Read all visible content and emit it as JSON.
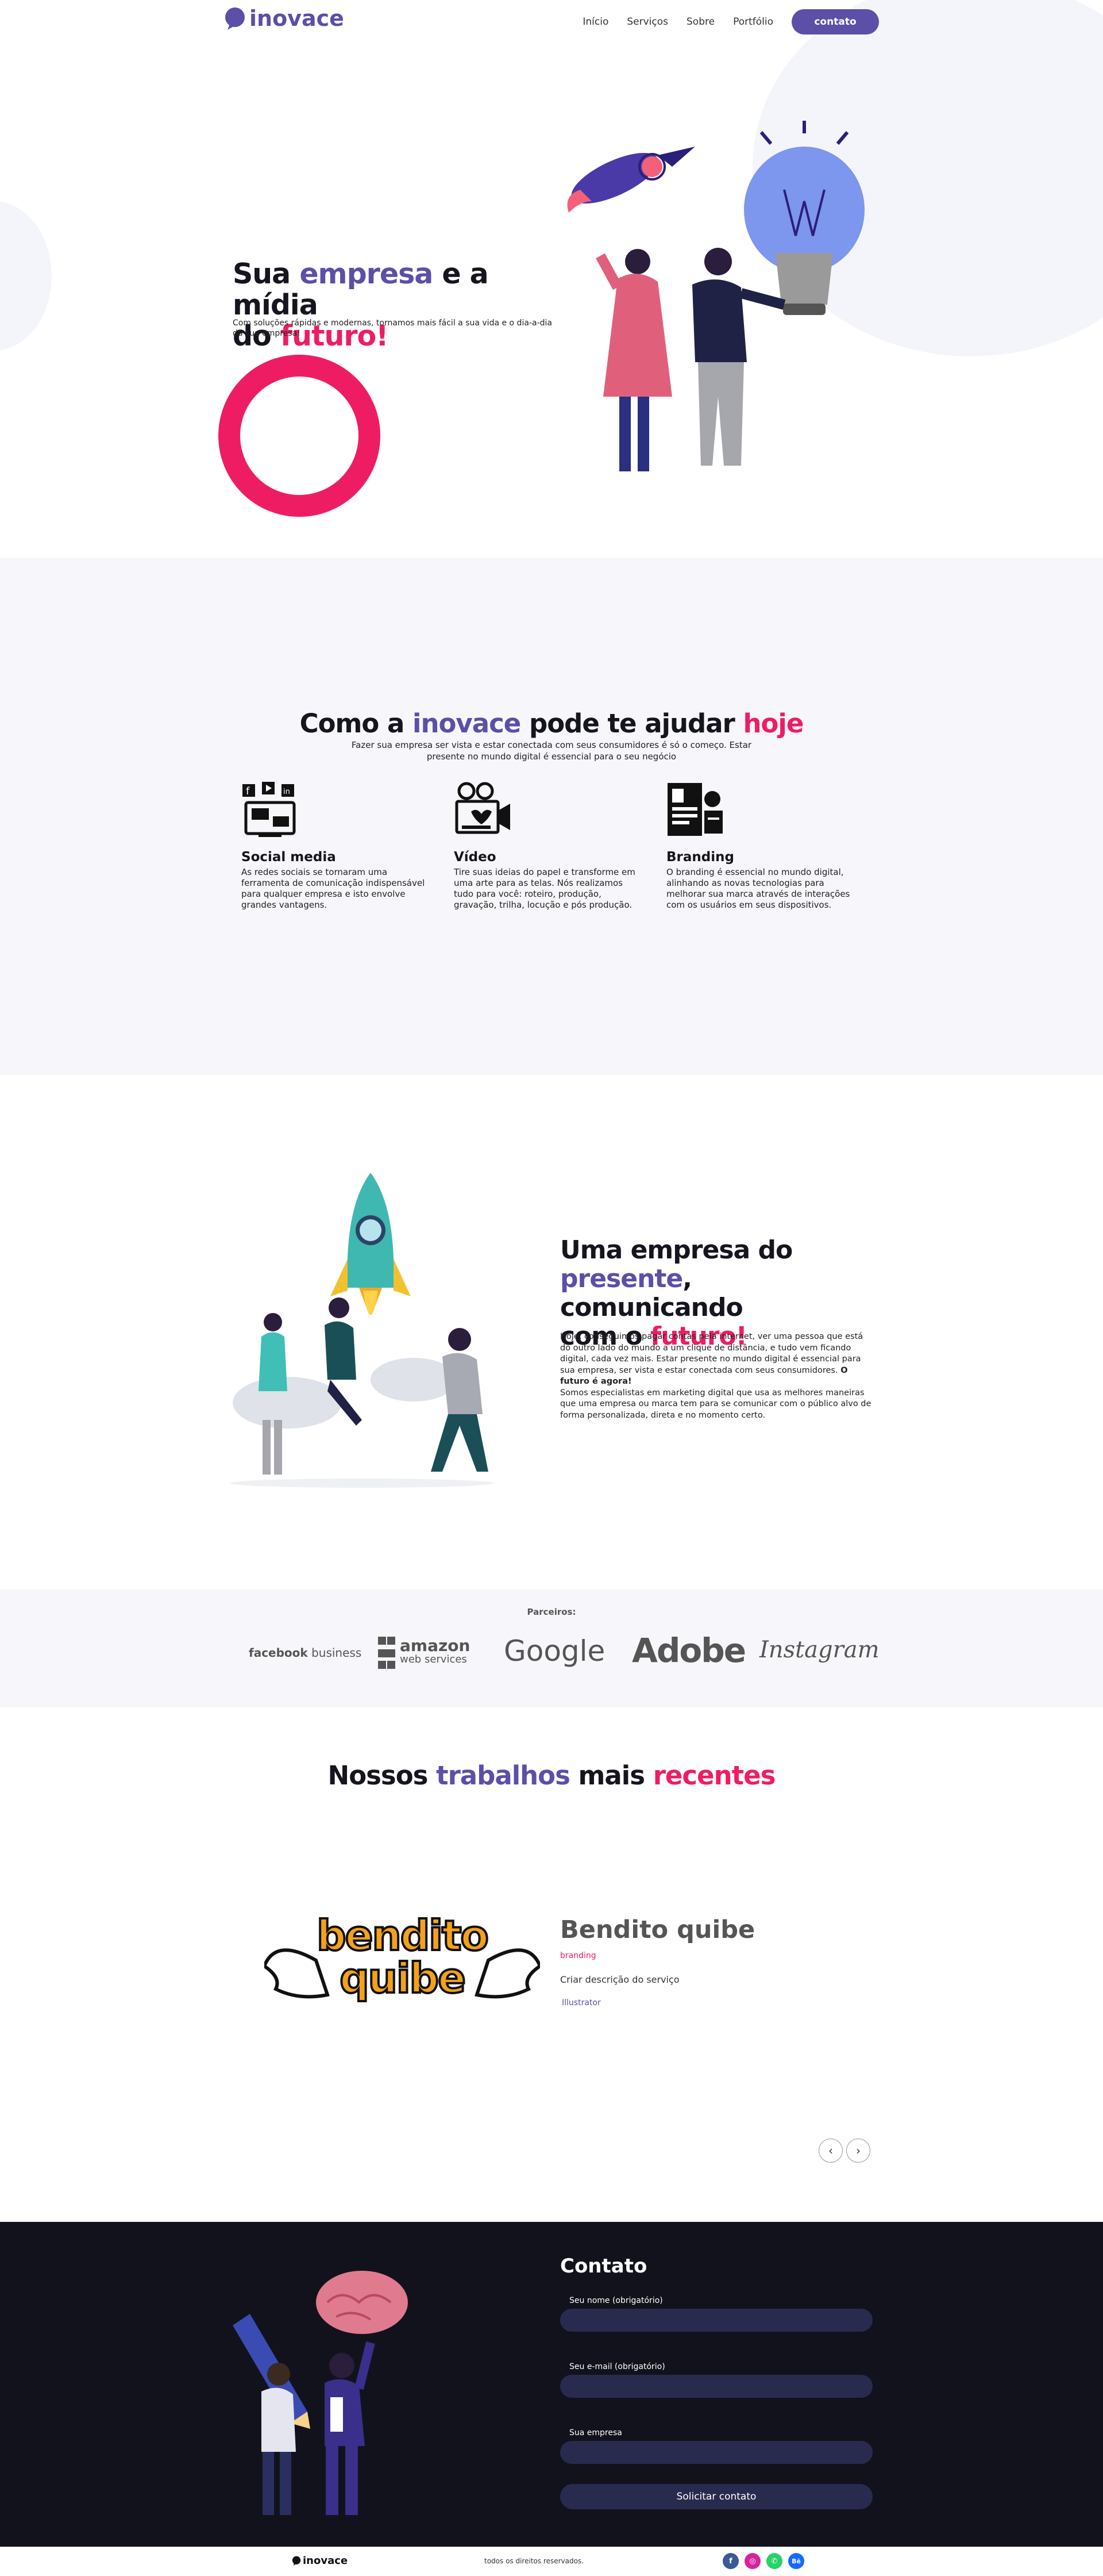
{
  "header": {
    "logo_text": "inovace",
    "nav": [
      "Início",
      "Serviços",
      "Sobre",
      "Portfólio"
    ],
    "cta": "contato"
  },
  "hero": {
    "title_1": "Sua ",
    "title_2": "empresa",
    "title_3": " e a mídia",
    "title_4": "do ",
    "title_5": "futuro!",
    "subtitle": "Com soluções rápidas e modernas, tornamos mais fácil a sua vida e o dia-a-dia da sua empresa!"
  },
  "services": {
    "title_1": "Como a ",
    "title_2": "inovace",
    "title_3": " pode te ajudar ",
    "title_4": "hoje",
    "subtitle": "Fazer sua empresa ser vista e estar conectada com seus consumidores é só o começo. Estar presente no mundo digital é essencial para o seu negócio",
    "items": [
      {
        "title": "Social media",
        "text": "As redes sociais se tornaram uma ferramenta de comunicação indispensável para qualquer empresa e isto envolve grandes vantagens.",
        "icon": "social-media-icon"
      },
      {
        "title": "Vídeo",
        "text": "Tire suas ideias do papel e transforme em uma arte para as telas. Nós realizamos tudo para você: roteiro, produção, gravação, trilha, locução e pós produção.",
        "icon": "video-icon"
      },
      {
        "title": "Branding",
        "text": "O branding é essencial no mundo digital, alinhando as novas tecnologias para melhorar sua marca através de interações com os usuários em seus dispositivos.",
        "icon": "branding-icon"
      }
    ]
  },
  "about": {
    "title_1": "Uma empresa do",
    "title_2": "presente",
    "title_3": ", comunicando",
    "title_4": "com o ",
    "title_5": "futuro!",
    "para_1": "Hoje, conseguimos pagar contas pela internet, ver uma pessoa que está do outro lado do mundo a um clique de distância, e tudo vem ficando digital, cada vez mais. Estar presente no mundo digital é essencial para sua empresa, ser vista e estar conectada com seus consumidores. ",
    "para_bold": "O futuro é agora!",
    "para_2": "Somos especialistas em marketing digital que usa as melhores maneiras que uma empresa ou marca tem para se comunicar com o público alvo de forma personalizada, direta e no momento certo."
  },
  "partners": {
    "label": "Parceiros:",
    "logos": [
      "facebook business",
      "amazon",
      "web services",
      "Google",
      "Adobe",
      "Instagram"
    ],
    "facebook_1": "facebook",
    "facebook_2": " business"
  },
  "works": {
    "title_1": "Nossos ",
    "title_2": "trabalhos",
    "title_3": " mais ",
    "title_4": "recentes",
    "project": {
      "logo_line_1": "bendito",
      "logo_line_2": "quibe",
      "name": "Bendito quibe",
      "category": "branding",
      "description": "Criar descrição do serviço",
      "tool": "Illustrator"
    },
    "prev": "‹",
    "next": "›"
  },
  "contact": {
    "title": "Contato",
    "fields": [
      {
        "label": "Seu nome (obrigatório)",
        "value": ""
      },
      {
        "label": "Seu e-mail (obrigatório)",
        "value": ""
      },
      {
        "label": "Sua empresa",
        "value": ""
      }
    ],
    "submit": "Solicitar contato"
  },
  "footer": {
    "logo_text": "inovace",
    "rights": "todos os direitos reservados.",
    "social": [
      {
        "icon": "facebook-icon",
        "glyph": "f",
        "color": "#3b5998"
      },
      {
        "icon": "instagram-icon",
        "glyph": "◎",
        "color": "#d6249f"
      },
      {
        "icon": "whatsapp-icon",
        "glyph": "✆",
        "color": "#25d366"
      },
      {
        "icon": "behance-icon",
        "glyph": "Bē",
        "color": "#1769ff"
      }
    ]
  },
  "colors": {
    "accent": "#5b4fa8",
    "highlight": "#ee1d63",
    "dark": "#12121c"
  }
}
